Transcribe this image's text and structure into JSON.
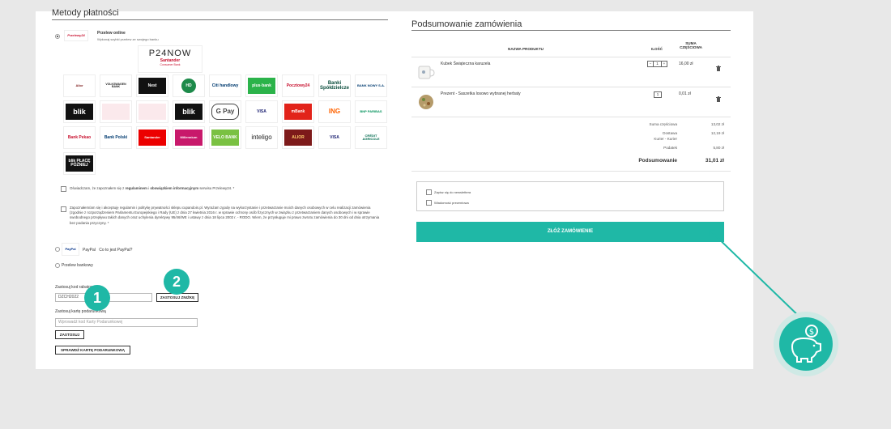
{
  "left": {
    "section_title": "Metody płatności",
    "online": {
      "logo": "Przelewy24",
      "title": "Przelew online",
      "subtitle": "Wykonaj szybki przelew ze swojego banku"
    },
    "hero": {
      "brand": "P24NOW",
      "sub1": "Santander",
      "sub2": "Consumer Bank"
    },
    "banks_row1": [
      "Alior",
      "VOLKSWAGEN BANK",
      "Nest",
      "HD",
      "Citi handlowy",
      "plus◦bank",
      "Pocztowy24",
      "Banki Spółdzielcze",
      "BANK NOWY S.A."
    ],
    "banks_row2": [
      "blik",
      "",
      "",
      "blik",
      "G Pay",
      "VISA",
      "mBank",
      "ING",
      "BNP PARIBAS"
    ],
    "banks_row3": [
      "Bank Pekao",
      "Bank Polski",
      "Santander",
      "Millennium",
      "VELO BANK",
      "inteligo",
      "ALIOR",
      "VISA",
      "CRÉDIT AGRICOLE"
    ],
    "banks_row4": [
      "blik PŁACĘ PÓŹNIEJ"
    ],
    "consent1_pre": "Oświadczam, że zapoznałem się z ",
    "consent1_link1": "regulaminem",
    "consent1_mid": " i ",
    "consent1_link2": "obowiązkiem informacyjnym",
    "consent1_post": " serwisu Przelewy24. *",
    "consent2": "Zapoznałem/am się i akceptuję regulamin i politykę prywatności sklepu cupandoin.pl. Wyrażam zgodę na wykorzystanie i przetwarzanie moich danych osobowych w celu realizacji zamówienia (zgodnie z rozporządzeniem Parlamentu Europejskiego i Rady (UE) z dnia 27 kwietnia 2016 r. w sprawie ochrony osób fizycznych w związku z przetwarzaniem danych osobowych i w sprawie swobodnego przepływu takich danych oraz uchylenia dyrektywy 95/46/WE i ustawy z dnia 18 lipca 2002 r. - RODO. Wiem, że przysługuje mi prawo zwrotu zamówienia do 30 dni od dnia otrzymania bez podania przyczyny. *",
    "paypal": {
      "logo": "PayPal",
      "label": "PayPal",
      "link": "Co to jest PayPal?"
    },
    "bank_transfer": "Przelew bankowy",
    "discount": {
      "label": "Zastosuj kod rabatowy",
      "value": "DZCH2022",
      "button": "ZASTOSUJ ZNIŻKĘ"
    },
    "giftcard": {
      "label": "Zastosuj kartę podarunkową",
      "placeholder": "Wprowadź kod Karty Podarunkowej",
      "apply": "ZASTOSUJ",
      "check": "SPRAWDŹ KARTĘ PODARUNKOWĄ"
    },
    "badge1": "1",
    "badge2": "2"
  },
  "right": {
    "section_title": "Podsumowanie zamówienia",
    "headers": {
      "name": "NAZWA PRODUKTU",
      "qty": "ILOŚĆ",
      "sum": "SUMA CZĘŚCIOWA"
    },
    "items": [
      {
        "name": "Kubek Świąteczna karuzela",
        "qty": "1",
        "price": "16,00 zł"
      },
      {
        "name": "Prezent - Saszetka losowo wybranej herbaty",
        "qty": "1",
        "price": "0,01 zł"
      }
    ],
    "totals": {
      "subtotal_label": "Suma częściowa",
      "subtotal": "13,02 zł",
      "delivery_label": "Dostawa",
      "delivery_sub": "Kurier - Kurier",
      "delivery": "12,19 zł",
      "tax_label": "Podatek",
      "tax": "5,80 zł",
      "total_label": "Podsumowanie",
      "total": "31,01 zł"
    },
    "newsletter": "Zapisz się do newslettera",
    "gift_message": "Wiadomość prezentowa",
    "cta": "ZŁÓŻ ZAMÓWIENIE"
  },
  "colors": {
    "accent": "#1fb8a6",
    "background": "#e8e8e8",
    "panel": "#ffffff"
  },
  "icons": {
    "trash": "trash-icon",
    "piggy": "piggy-bank-coin-icon"
  }
}
